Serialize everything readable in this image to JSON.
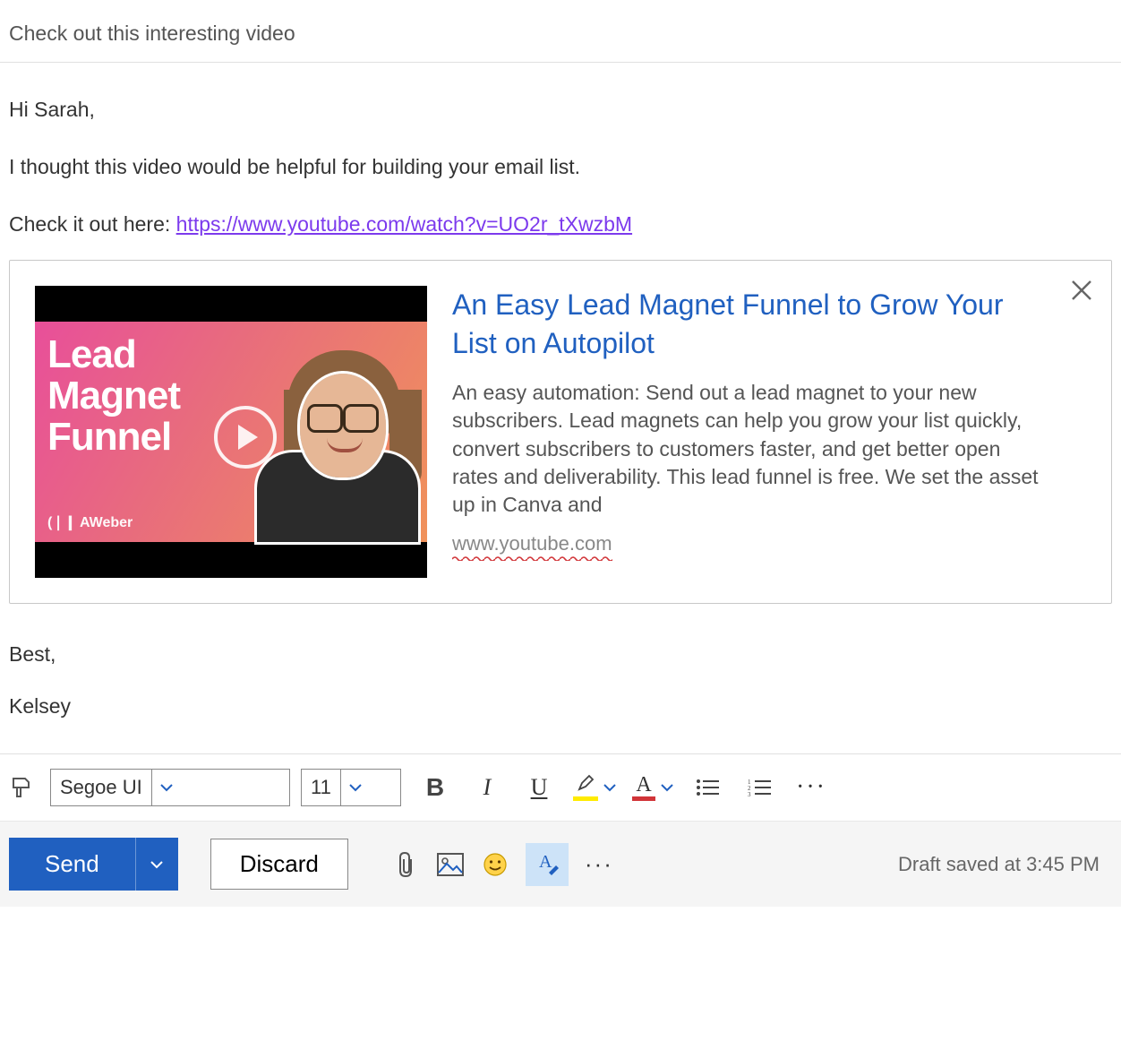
{
  "subject": "Check out this interesting video",
  "body": {
    "greeting": "Hi Sarah,",
    "line1": "I thought this video would be helpful for building your email list.",
    "link_intro": "Check it out here: ",
    "link_text": "https://www.youtube.com/watch?v=UO2r_tXwzbM"
  },
  "preview": {
    "thumb_title": "Lead Magnet Funnel",
    "thumb_brand": "(❘❙ AWeber",
    "title": "An Easy Lead Magnet Funnel to Grow Your List on Autopilot",
    "description": "An easy automation: Send out a lead magnet to your new subscribers. Lead magnets can help you grow your list quickly, convert subscribers to customers faster, and get better open rates and deliverability. This lead funnel is free. We set the asset up in Canva and",
    "domain": "www.youtube.com"
  },
  "signature": {
    "closing": "Best,",
    "name": "Kelsey"
  },
  "fmt": {
    "font_name": "Segoe UI",
    "font_size": "11"
  },
  "actions": {
    "send": "Send",
    "discard": "Discard",
    "draft_status": "Draft saved at 3:45 PM"
  }
}
